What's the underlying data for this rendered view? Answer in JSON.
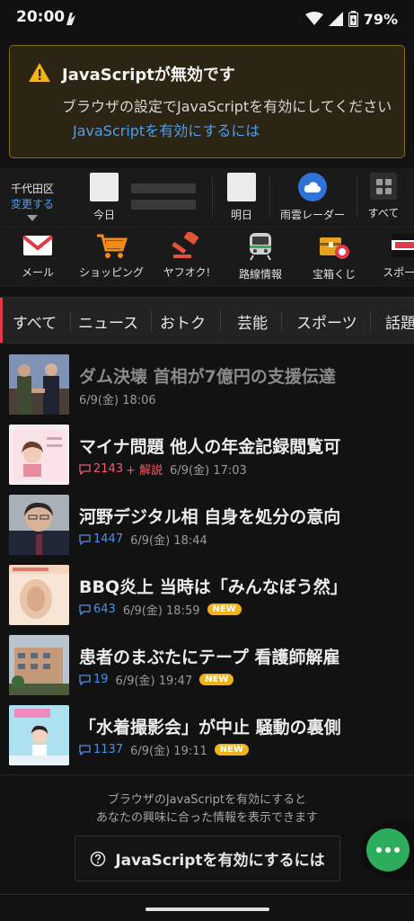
{
  "status_bar": {
    "time": "20:00",
    "battery": "79%"
  },
  "js_warning": {
    "title": "JavaScriptが無効です",
    "body": "ブラウザの設定でJavaScriptを有効にしてください",
    "link": "JavaScriptを有効にするには"
  },
  "weather": {
    "location": "千代田区",
    "change": "変更する",
    "today": "今日",
    "tomorrow": "明日",
    "radar": "雨雲レーダー",
    "all": "すべて"
  },
  "services": [
    {
      "label": "メール",
      "icon": "mail-icon"
    },
    {
      "label": "ショッピング",
      "icon": "cart-icon"
    },
    {
      "label": "ヤフオク!",
      "icon": "gavel-icon"
    },
    {
      "label": "路線情報",
      "icon": "train-icon"
    },
    {
      "label": "宝箱くじ",
      "icon": "treasure-icon"
    },
    {
      "label": "スポーツ",
      "icon": "sports-icon"
    }
  ],
  "tabs": [
    "すべて",
    "ニュース",
    "おトク",
    "芸能",
    "スポーツ",
    "話題"
  ],
  "news": [
    {
      "title": "ダム決壊 首相が7億円の支援伝達",
      "comments": "",
      "extra": "",
      "date": "6/9(金) 18:06",
      "is_new": false,
      "read": true
    },
    {
      "title": "マイナ問題 他人の年金記録閲覧可",
      "comments": "2143",
      "extra": "+ 解説",
      "date": "6/9(金) 17:03",
      "is_new": false,
      "read": false
    },
    {
      "title": "河野デジタル相 自身を処分の意向",
      "comments": "1447",
      "extra": "",
      "date": "6/9(金) 18:44",
      "is_new": false,
      "read": false
    },
    {
      "title": "BBQ炎上 当時は「みんなぼう然」",
      "comments": "643",
      "extra": "",
      "date": "6/9(金) 18:59",
      "is_new": true,
      "read": false
    },
    {
      "title": "患者のまぶたにテープ 看護師解雇",
      "comments": "19",
      "extra": "",
      "date": "6/9(金) 19:47",
      "is_new": true,
      "read": false
    },
    {
      "title": "「水着撮影会」が中止 騒動の裏側",
      "comments": "1137",
      "extra": "",
      "date": "6/9(金) 19:11",
      "is_new": true,
      "read": false
    }
  ],
  "new_label": "NEW",
  "bottom": {
    "note_line1": "ブラウザのJavaScriptを有効にすると",
    "note_line2": "あなたの興味に合った情報を表示できます",
    "button": "JavaScriptを有効にするには"
  },
  "colors": {
    "accent_red": "#e0394a",
    "link_blue": "#4f9cf0",
    "new_badge": "#f0b41a",
    "fab_green": "#2dac5c"
  }
}
